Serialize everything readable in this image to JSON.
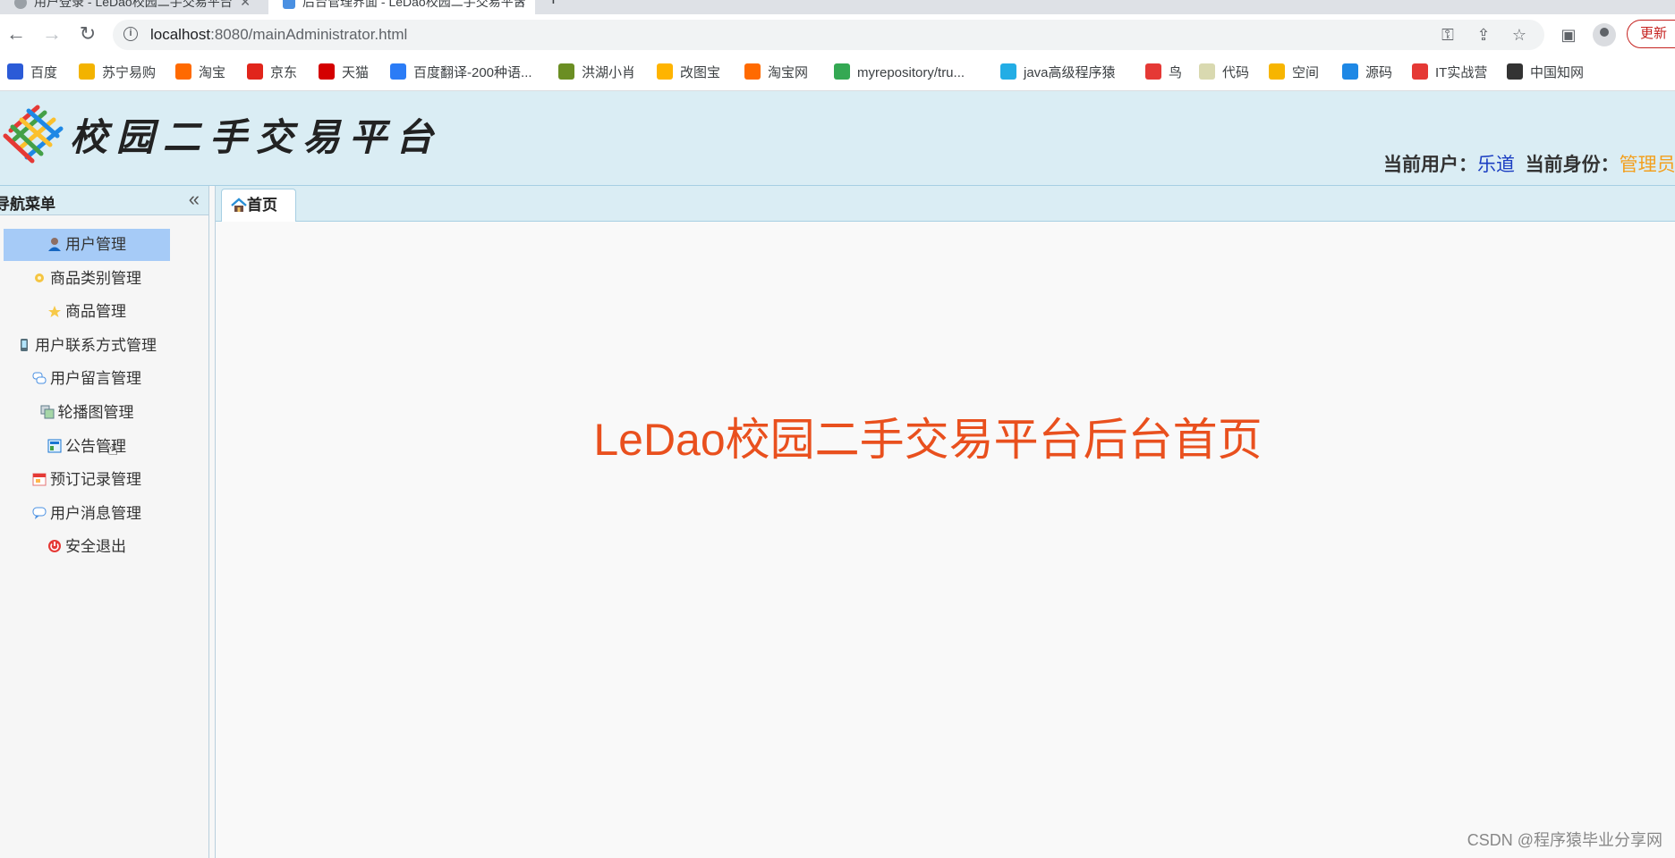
{
  "browser": {
    "tabs": [
      {
        "title": "用户登录 - LeDao校园二手交易平台"
      },
      {
        "title": "后台管理界面 - LeDao校园二手交易平台"
      }
    ],
    "url_host": "localhost",
    "url_rest": ":8080/mainAdministrator.html",
    "update_label": "更新",
    "bookmarks": [
      {
        "label": "百度",
        "icon": "baidu-icon",
        "color": "#2b5bd7"
      },
      {
        "label": "苏宁易购",
        "icon": "suning-icon",
        "color": "#f3b300"
      },
      {
        "label": "淘宝",
        "icon": "taobao-icon",
        "color": "#ff6a00"
      },
      {
        "label": "京东",
        "icon": "jd-icon",
        "color": "#e1251b"
      },
      {
        "label": "天猫",
        "icon": "tmall-icon",
        "color": "#d40000"
      },
      {
        "label": "百度翻译-200种语...",
        "icon": "baidu-translate-icon",
        "color": "#2b7cf6"
      },
      {
        "label": "洪湖小肖",
        "icon": "bird-icon",
        "color": "#6b8e23"
      },
      {
        "label": "改图宝",
        "icon": "gaitubao-icon",
        "color": "#ffb400"
      },
      {
        "label": "淘宝网",
        "icon": "taobao-icon",
        "color": "#ff6a00"
      },
      {
        "label": "myrepository/tru...",
        "icon": "chrome-icon",
        "color": "#34a853"
      },
      {
        "label": "java高级程序猿",
        "icon": "bilibili-icon",
        "color": "#23ade5"
      },
      {
        "label": "鸟",
        "icon": "bird-icon",
        "color": "#e53935"
      },
      {
        "label": "代码",
        "icon": "code-icon",
        "color": "#d9d9b0"
      },
      {
        "label": "空间",
        "icon": "qzone-icon",
        "color": "#f7b500"
      },
      {
        "label": "源码",
        "icon": "source-icon",
        "color": "#1e88e5"
      },
      {
        "label": "IT实战营",
        "icon": "it-icon",
        "color": "#e53935"
      },
      {
        "label": "中国知网",
        "icon": "cnki-icon",
        "color": "#333333"
      }
    ]
  },
  "header": {
    "site_title": "校园二手交易平台",
    "current_user_label": "当前用户：",
    "current_user": "乐道",
    "current_role_label": "当前身份：",
    "current_role": "管理员"
  },
  "sidebar": {
    "title": "导航菜单",
    "collapse_icon": "«",
    "items": [
      {
        "label": "用户管理",
        "icon": "user-icon",
        "active": true
      },
      {
        "label": "商品类别管理",
        "icon": "category-icon",
        "active": false
      },
      {
        "label": "商品管理",
        "icon": "star-icon",
        "active": false
      },
      {
        "label": "用户联系方式管理",
        "icon": "phone-icon",
        "active": false
      },
      {
        "label": "用户留言管理",
        "icon": "comments-icon",
        "active": false
      },
      {
        "label": "轮播图管理",
        "icon": "slides-icon",
        "active": false
      },
      {
        "label": "公告管理",
        "icon": "notice-icon",
        "active": false
      },
      {
        "label": "预订记录管理",
        "icon": "booking-icon",
        "active": false
      },
      {
        "label": "用户消息管理",
        "icon": "message-icon",
        "active": false
      },
      {
        "label": "安全退出",
        "icon": "power-icon",
        "active": false
      }
    ]
  },
  "main": {
    "tab_label": "首页",
    "welcome_text": "LeDao校园二手交易平台后台首页"
  },
  "watermark": "CSDN @程序猿毕业分享网"
}
